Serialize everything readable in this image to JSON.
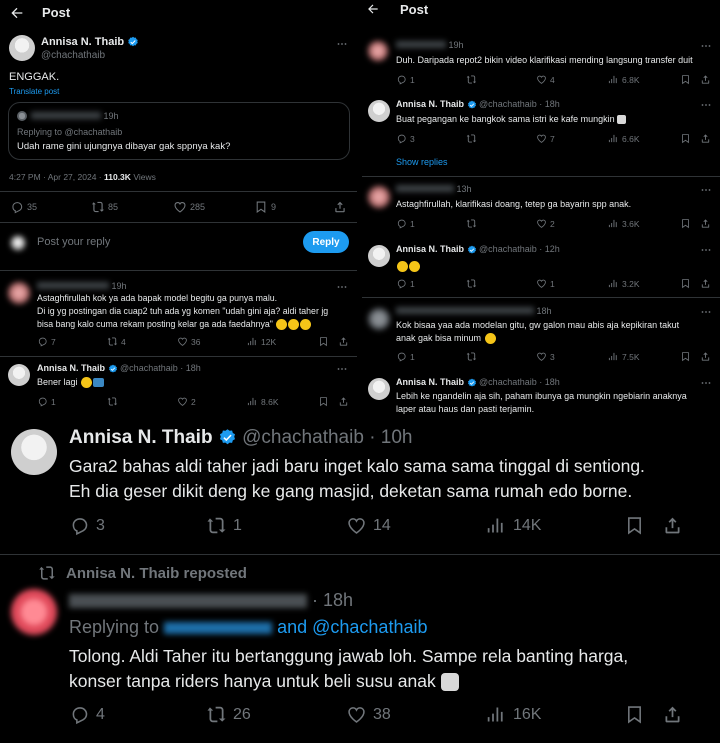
{
  "left": {
    "header_title": "Post",
    "author": {
      "name": "Annisa N. Thaib",
      "handle": "@chachathaib"
    },
    "main_text": "ENGGAK.",
    "translate": "Translate post",
    "quote": {
      "time": "19h",
      "replying_label": "Replying to @chachathaib",
      "text": "Udah rame gini ujungnya dibayar gak sppnya kak?"
    },
    "timestamp": "4:27 PM · Apr 27, 2024 ·",
    "views_count": "110.3K",
    "views_label": "Views",
    "stats": {
      "replies": "35",
      "reposts": "85",
      "likes": "285",
      "bookmarks": "9"
    },
    "compose_placeholder": "Post your reply",
    "reply_button": "Reply",
    "reply1": {
      "time": "19h",
      "lines": [
        "Astaghfirullah kok ya ada bapak model begitu ga punya malu.",
        "Di ig yg postingan dia cuap2 tuh ada yg komen \"udah gini aja? aldi taher jg",
        "bisa bang kalo cuma rekam posting kelar ga ada faedahnya\""
      ],
      "stats": {
        "replies": "7",
        "reposts": "4",
        "likes": "36",
        "views": "12K"
      }
    },
    "reply2": {
      "name": "Annisa N. Thaib",
      "handle": "@chachathaib",
      "time": "18h",
      "text": "Bener lagi",
      "stats": {
        "replies": "1",
        "likes": "2",
        "views": "8.6K"
      }
    }
  },
  "right": {
    "header_title": "Post",
    "t1": {
      "time": "19h",
      "text": "Duh. Daripada repot2 bikin video klarifikasi mending langsung transfer duit",
      "stats": {
        "replies": "1",
        "likes": "4",
        "views": "6.8K"
      }
    },
    "t2": {
      "name": "Annisa N. Thaib",
      "handle": "@chachathaib",
      "time": "18h",
      "text": "Buat pegangan ke bangkok sama istri ke kafe mungkin",
      "stats": {
        "replies": "3",
        "likes": "7",
        "views": "6.6K"
      }
    },
    "show_replies": "Show replies",
    "t3": {
      "time": "13h",
      "text": "Astaghfirullah, klarifikasi doang, tetep ga bayarin spp anak.",
      "stats": {
        "replies": "1",
        "likes": "2",
        "views": "3.6K"
      }
    },
    "t4": {
      "name": "Annisa N. Thaib",
      "handle": "@chachathaib",
      "time": "12h",
      "stats": {
        "replies": "1",
        "likes": "1",
        "views": "3.2K"
      }
    },
    "t5": {
      "time": "18h",
      "lines": [
        "Kok bisaa yaa ada modelan gitu, gw galon mau abis aja kepikiran takut",
        "anak gak bisa minum"
      ],
      "stats": {
        "replies": "1",
        "likes": "3",
        "views": "7.5K"
      }
    },
    "t6": {
      "name": "Annisa N. Thaib",
      "handle": "@chachathaib",
      "time": "18h",
      "lines": [
        "Lebih ke ngandelin aja sih, paham ibunya ga mungkin ngebiarin anaknya",
        "laper atau haus dan pasti terjamin."
      ]
    }
  },
  "bottom": {
    "t1": {
      "name": "Annisa N. Thaib",
      "handle": "@chachathaib",
      "time": "10h",
      "lines": [
        "Gara2 bahas aldi taher jadi baru inget kalo sama sama tinggal di sentiong.",
        "Eh dia geser dikit deng ke gang masjid, deketan sama rumah edo borne."
      ],
      "stats": {
        "replies": "3",
        "reposts": "1",
        "likes": "14",
        "views": "14K"
      }
    },
    "repost_label": "Annisa N. Thaib reposted",
    "t2": {
      "time": "18h",
      "replying_prefix": "Replying to",
      "replying_and": "and @chachathaib",
      "lines": [
        "Tolong. Aldi Taher itu bertanggung jawab loh. Sampe rela banting harga,",
        "konser tanpa riders hanya untuk beli susu anak"
      ],
      "stats": {
        "replies": "4",
        "reposts": "26",
        "likes": "38",
        "views": "16K"
      }
    }
  },
  "colors": {
    "accent": "#1d9bf0",
    "text": "#e7e9ea",
    "muted": "#71767b",
    "border": "#2f3336",
    "bg": "#000000"
  },
  "icons": [
    "back-arrow-icon",
    "verified-badge-icon",
    "more-icon",
    "reply-icon",
    "repost-icon",
    "like-icon",
    "views-icon",
    "bookmark-icon",
    "share-icon",
    "emoji-icon"
  ]
}
